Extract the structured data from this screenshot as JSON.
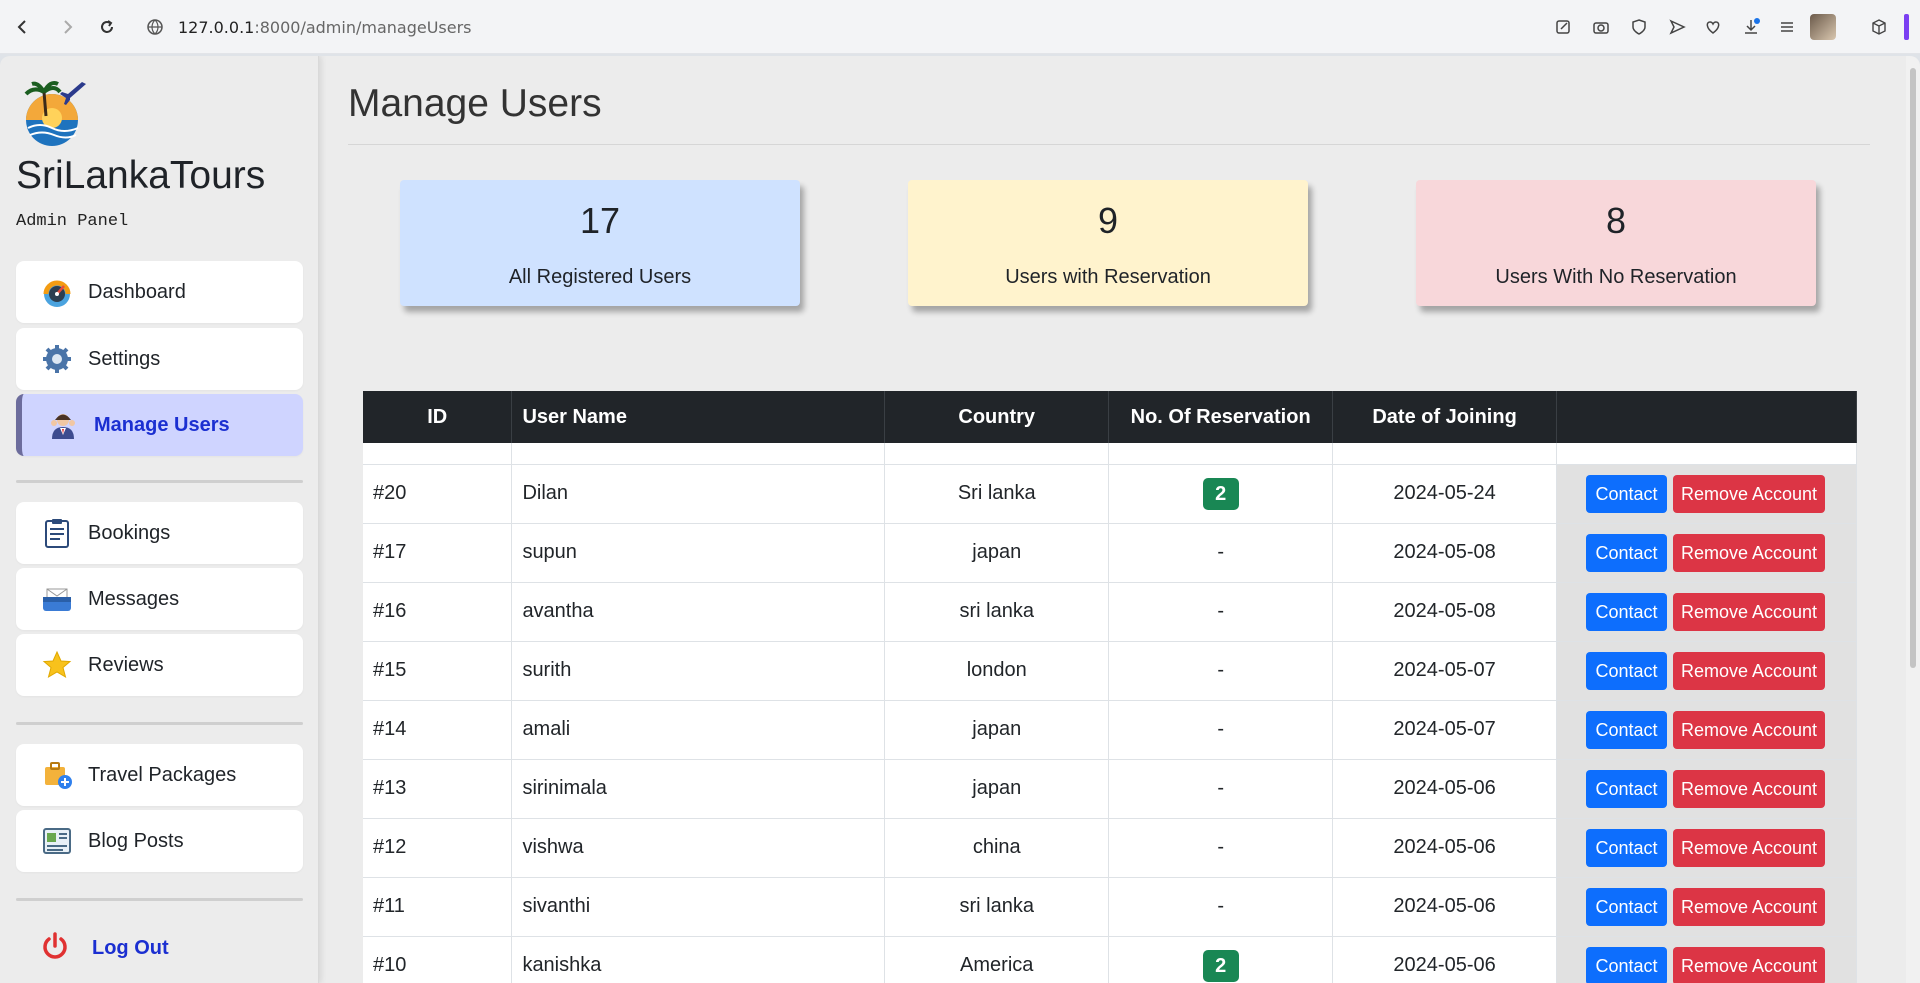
{
  "browser": {
    "url_host": "127.0.0.1",
    "url_path": ":8000/admin/manageUsers"
  },
  "sidebar": {
    "brand": "SriLankaTours",
    "subtitle": "Admin Panel",
    "items": [
      {
        "label": "Dashboard",
        "icon": "gauge-icon"
      },
      {
        "label": "Settings",
        "icon": "gear-icon"
      },
      {
        "label": "Manage Users",
        "icon": "users-icon",
        "active": true
      },
      {
        "label": "Bookings",
        "icon": "clipboard-icon"
      },
      {
        "label": "Messages",
        "icon": "mailbox-icon"
      },
      {
        "label": "Reviews",
        "icon": "star-icon"
      },
      {
        "label": "Travel Packages",
        "icon": "package-icon"
      },
      {
        "label": "Blog Posts",
        "icon": "blog-icon"
      }
    ],
    "logout": "Log Out"
  },
  "main": {
    "title": "Manage Users",
    "stats": [
      {
        "value": "17",
        "label": "All Registered Users",
        "color": "#cfe2ff"
      },
      {
        "value": "9",
        "label": "Users with Reservation",
        "color": "#fff3cd"
      },
      {
        "value": "8",
        "label": "Users With No Reservation",
        "color": "#f8d7da"
      }
    ],
    "table": {
      "headers": [
        "ID",
        "User Name",
        "Country",
        "No. Of Reservation",
        "Date of Joining",
        ""
      ],
      "contact_label": "Contact",
      "remove_label": "Remove Account",
      "rows": [
        {
          "id": "#20",
          "name": "Dilan",
          "country": "Sri lanka",
          "reservations": "2",
          "date": "2024-05-24"
        },
        {
          "id": "#17",
          "name": "supun",
          "country": "japan",
          "reservations": "-",
          "date": "2024-05-08"
        },
        {
          "id": "#16",
          "name": "avantha",
          "country": "sri lanka",
          "reservations": "-",
          "date": "2024-05-08"
        },
        {
          "id": "#15",
          "name": "surith",
          "country": "london",
          "reservations": "-",
          "date": "2024-05-07"
        },
        {
          "id": "#14",
          "name": "amali",
          "country": "japan",
          "reservations": "-",
          "date": "2024-05-07"
        },
        {
          "id": "#13",
          "name": "sirinimala",
          "country": "japan",
          "reservations": "-",
          "date": "2024-05-06"
        },
        {
          "id": "#12",
          "name": "vishwa",
          "country": "china",
          "reservations": "-",
          "date": "2024-05-06"
        },
        {
          "id": "#11",
          "name": "sivanthi",
          "country": "sri lanka",
          "reservations": "-",
          "date": "2024-05-06"
        },
        {
          "id": "#10",
          "name": "kanishka",
          "country": "America",
          "reservations": "2",
          "date": "2024-05-06"
        }
      ]
    }
  }
}
